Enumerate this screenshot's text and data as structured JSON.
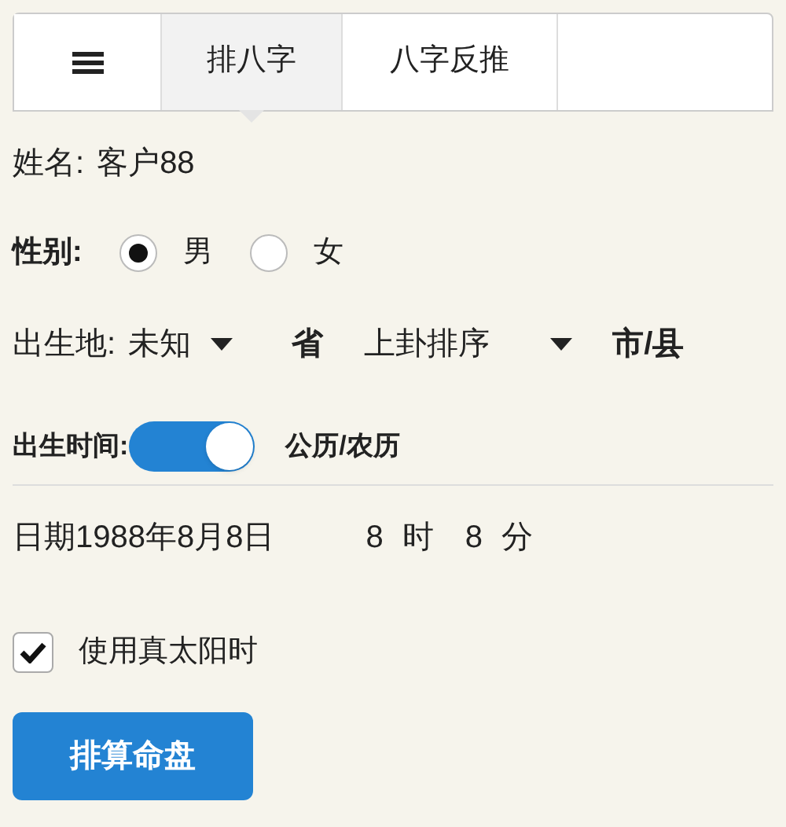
{
  "tabs": [
    {
      "label": "排八字",
      "selected": true
    },
    {
      "label": "八字反推",
      "selected": false
    }
  ],
  "name": {
    "label": "姓名:",
    "value": "客户88"
  },
  "gender": {
    "label": "性别:",
    "options": [
      {
        "label": "男",
        "selected": true
      },
      {
        "label": "女",
        "selected": false
      }
    ]
  },
  "birthplace": {
    "label": "出生地:",
    "province": {
      "value": "未知",
      "unit": "省"
    },
    "city": {
      "value": "上卦排序",
      "unit": "市/县"
    }
  },
  "birth_time": {
    "label": "出生时间:",
    "on": true,
    "mode_label": "公历/农历"
  },
  "date": {
    "label": "日期",
    "value": "1988年8月8日",
    "hour": "8",
    "hour_unit": "时",
    "minute": "8",
    "minute_unit": "分"
  },
  "true_solar_time": {
    "label": "使用真太阳时",
    "checked": true
  },
  "submit": {
    "label": "排算命盘"
  }
}
